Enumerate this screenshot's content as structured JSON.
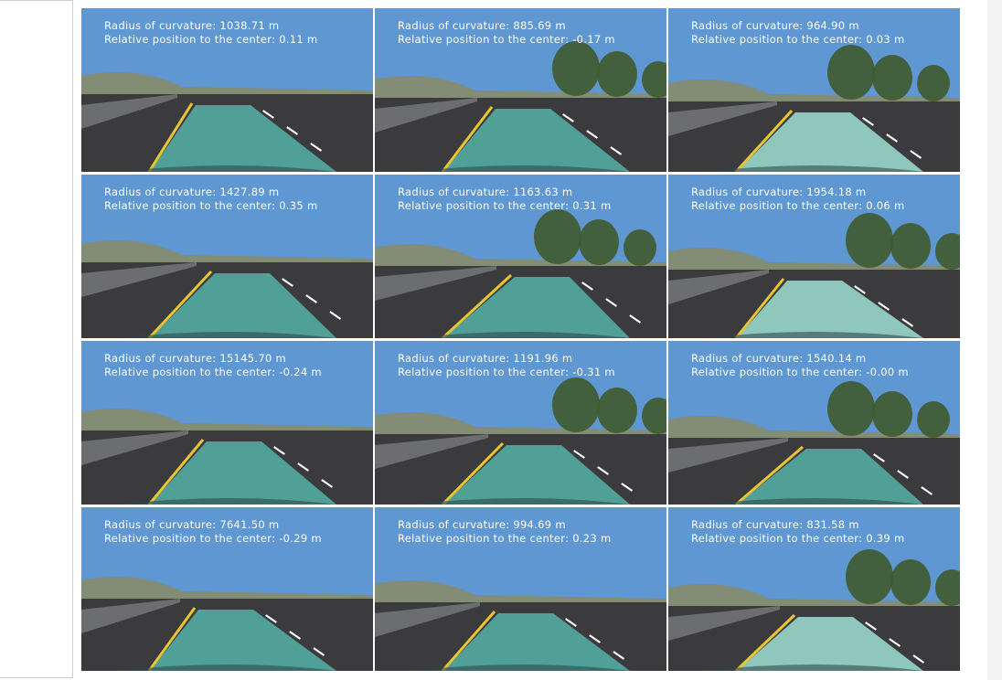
{
  "captions": [
    {
      "radius": "Radius of curvature: 1038.71 m",
      "position": "Relative position to the center: 0.11 m"
    },
    {
      "radius": "Radius of curvature: 885.69 m",
      "position": "Relative position to the center: -0.17 m"
    },
    {
      "radius": "Radius of curvature: 964.90 m",
      "position": "Relative position to the center: 0.03 m"
    },
    {
      "radius": "Radius of curvature: 1427.89 m",
      "position": "Relative position to the center: 0.35 m"
    },
    {
      "radius": "Radius of curvature: 1163.63 m",
      "position": "Relative position to the center: 0.31 m"
    },
    {
      "radius": "Radius of curvature: 1954.18 m",
      "position": "Relative position to the center: 0.06 m"
    },
    {
      "radius": "Radius of curvature: 15145.70 m",
      "position": "Relative position to the center: -0.24 m"
    },
    {
      "radius": "Radius of curvature: 1191.96 m",
      "position": "Relative position to the center: -0.31 m"
    },
    {
      "radius": "Radius of curvature: 1540.14 m",
      "position": "Relative position to the center: -0.00 m"
    },
    {
      "radius": "Radius of curvature: 7641.50 m",
      "position": "Relative position to the center: -0.29 m"
    },
    {
      "radius": "Radius of curvature: 994.69 m",
      "position": "Relative position to the center: 0.23 m"
    },
    {
      "radius": "Radius of curvature: 831.58 m",
      "position": "Relative position to the center: 0.39 m"
    }
  ],
  "colors": {
    "sky": "#5f97d3",
    "road": "#3b3b3e",
    "lane_overlay": "#56b3a8",
    "lane_overlay_light": "#9fe0d2",
    "yellow_line": "#e8c531",
    "hill": "#8a8a63"
  }
}
